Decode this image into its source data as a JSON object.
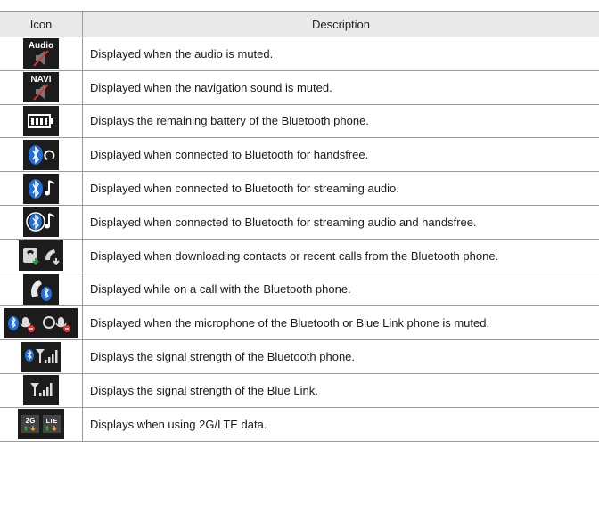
{
  "header": {
    "icon": "Icon",
    "description": "Description"
  },
  "rows": [
    {
      "icon": "audio-muted-icon",
      "label": "Audio",
      "description": "Displayed when the audio is muted."
    },
    {
      "icon": "navi-muted-icon",
      "label": "NAVI",
      "description": "Displayed when the navigation sound is muted."
    },
    {
      "icon": "battery-icon",
      "description": "Displays the remaining battery of the Bluetooth phone."
    },
    {
      "icon": "bluetooth-handsfree-icon",
      "description": "Displayed when connected to Bluetooth for handsfree."
    },
    {
      "icon": "bluetooth-streaming-icon",
      "description": "Displayed when connected to Bluetooth for streaming audio."
    },
    {
      "icon": "bluetooth-streaming-handsfree-icon",
      "description": "Displayed when connected to Bluetooth for streaming audio and handsfree."
    },
    {
      "icon": "download-contacts-icon",
      "description": "Displayed when downloading contacts or recent calls from the Bluetooth phone."
    },
    {
      "icon": "bluetooth-call-icon",
      "description": "Displayed while on a call with the Bluetooth phone."
    },
    {
      "icon": "microphone-muted-icon",
      "description": "Displayed when the microphone of the Bluetooth or Blue Link phone is muted."
    },
    {
      "icon": "bluetooth-signal-icon",
      "description": "Displays the signal strength of the Bluetooth phone."
    },
    {
      "icon": "bluelink-signal-icon",
      "description": "Displays the signal strength of the Blue Link."
    },
    {
      "icon": "data-2g-lte-icon",
      "label_a": "2G",
      "label_b": "LTE",
      "description": "Displays when using 2G/LTE data."
    }
  ],
  "colors": {
    "icon_bg": "#1c1c1c",
    "bluetooth": "#1e6fd9",
    "mute_red": "#e03030",
    "header_bg": "#e9e9e9"
  }
}
